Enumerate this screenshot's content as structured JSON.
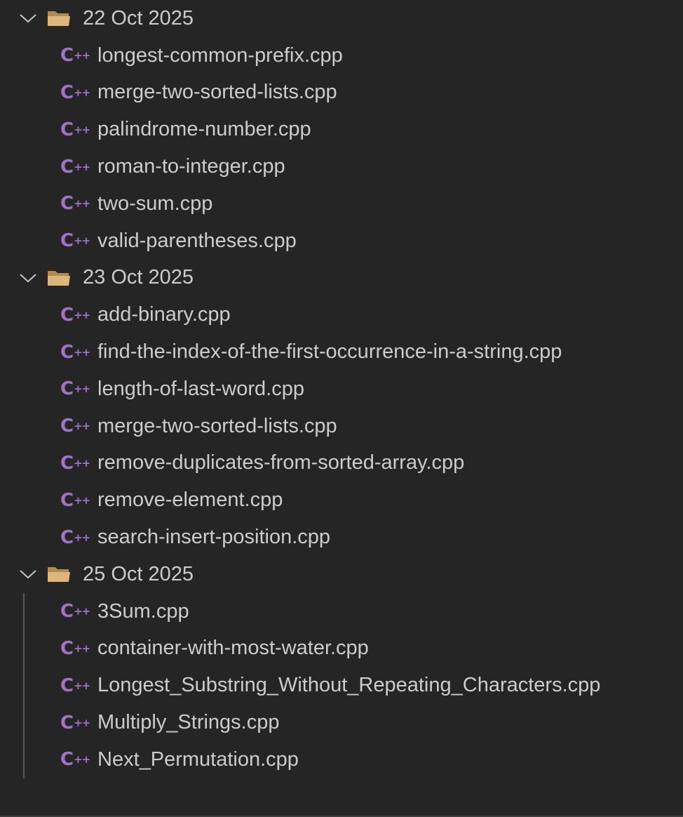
{
  "explorer": {
    "folders": [
      {
        "name": "22 Oct 2025",
        "files": [
          "longest-common-prefix.cpp",
          "merge-two-sorted-lists.cpp",
          "palindrome-number.cpp",
          "roman-to-integer.cpp",
          "two-sum.cpp",
          "valid-parentheses.cpp"
        ]
      },
      {
        "name": "23 Oct 2025",
        "files": [
          "add-binary.cpp",
          "find-the-index-of-the-first-occurrence-in-a-string.cpp",
          "length-of-last-word.cpp",
          "merge-two-sorted-lists.cpp",
          "remove-duplicates-from-sorted-array.cpp",
          "remove-element.cpp",
          "search-insert-position.cpp"
        ]
      },
      {
        "name": "25 Oct 2025",
        "files": [
          "3Sum.cpp",
          "container-with-most-water.cpp",
          "Longest_Substring_Without_Repeating_Characters.cpp",
          "Multiply_Strings.cpp",
          "Next_Permutation.cpp"
        ]
      }
    ],
    "icons": {
      "folder": "open-folder-icon",
      "chevron": "chevron-down-icon",
      "file": "cpp-file-icon",
      "file_glyph_main": "C",
      "file_glyph_suffix": "++"
    },
    "colors": {
      "background": "#252526",
      "text": "#cccccc",
      "cpp_icon": "#a074c4",
      "folder": "#dcb67a"
    }
  }
}
